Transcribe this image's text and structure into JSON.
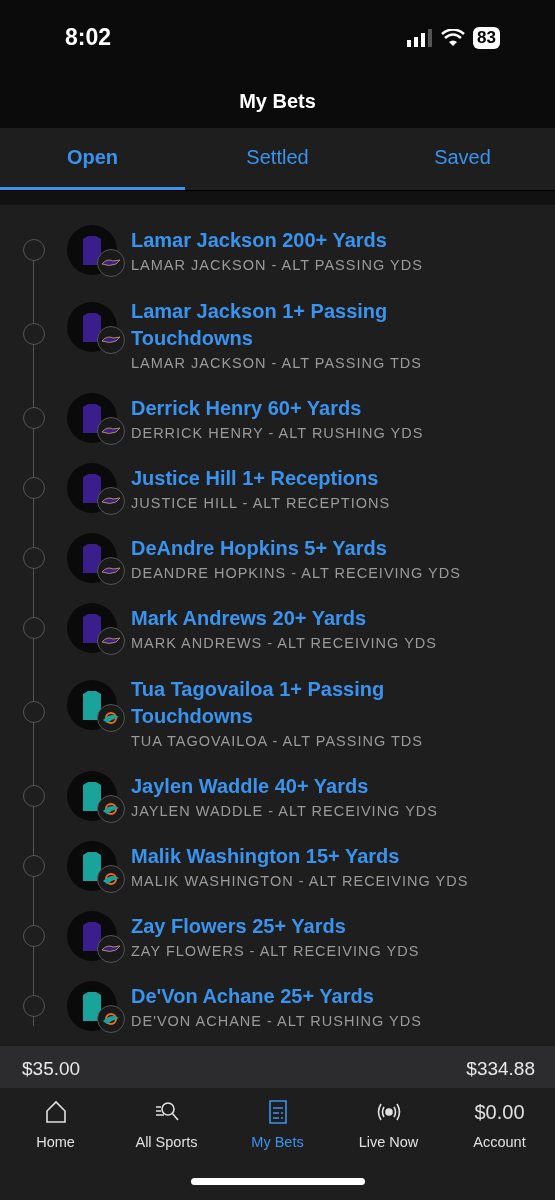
{
  "status_bar": {
    "time": "8:02",
    "battery": "83"
  },
  "header": {
    "title": "My Bets"
  },
  "tabs": [
    {
      "label": "Open",
      "selected": true
    },
    {
      "label": "Settled",
      "selected": false
    },
    {
      "label": "Saved",
      "selected": false
    }
  ],
  "bets": [
    {
      "title": "Lamar Jackson 200+ Yards",
      "subtitle": "LAMAR JACKSON - ALT PASSING YDS",
      "color": "#3a1f8c",
      "kind": "bird"
    },
    {
      "title": "Lamar Jackson 1+ Passing Touchdowns",
      "subtitle": "LAMAR JACKSON - ALT PASSING TDS",
      "color": "#3a1f8c",
      "kind": "bird"
    },
    {
      "title": "Derrick Henry 60+ Yards",
      "subtitle": "DERRICK HENRY - ALT RUSHING YDS",
      "color": "#3a1f8c",
      "kind": "bird"
    },
    {
      "title": "Justice Hill 1+ Receptions",
      "subtitle": "JUSTICE HILL - ALT RECEPTIONS",
      "color": "#3a1f8c",
      "kind": "bird"
    },
    {
      "title": "DeAndre Hopkins 5+ Yards",
      "subtitle": "DEANDRE HOPKINS - ALT RECEIVING YDS",
      "color": "#3a1f8c",
      "kind": "bird"
    },
    {
      "title": "Mark Andrews 20+ Yards",
      "subtitle": "MARK ANDREWS - ALT RECEIVING YDS",
      "color": "#3a1f8c",
      "kind": "bird"
    },
    {
      "title": "Tua Tagovailoa 1+ Passing Touchdowns",
      "subtitle": "TUA TAGOVAILOA - ALT PASSING TDS",
      "color": "#1aa39a",
      "kind": "fish"
    },
    {
      "title": "Jaylen Waddle 40+ Yards",
      "subtitle": "JAYLEN WADDLE - ALT RECEIVING YDS",
      "color": "#1aa39a",
      "kind": "fish"
    },
    {
      "title": "Malik Washington 15+ Yards",
      "subtitle": "MALIK WASHINGTON - ALT RECEIVING YDS",
      "color": "#1aa39a",
      "kind": "fish"
    },
    {
      "title": "Zay Flowers 25+ Yards",
      "subtitle": "ZAY FLOWERS - ALT RECEIVING YDS",
      "color": "#3a1f8c",
      "kind": "bird"
    },
    {
      "title": "De'Von Achane 25+ Yards",
      "subtitle": "DE'VON ACHANE - ALT RUSHING YDS",
      "color": "#1aa39a",
      "kind": "fish"
    }
  ],
  "summary": {
    "wager": "$35.00",
    "payout": "$334.88"
  },
  "nav": [
    {
      "label": "Home",
      "kind": "home",
      "selected": false
    },
    {
      "label": "All Sports",
      "kind": "search",
      "selected": false
    },
    {
      "label": "My Bets",
      "kind": "slip",
      "selected": true
    },
    {
      "label": "Live Now",
      "kind": "live",
      "selected": false
    },
    {
      "label": "Account",
      "kind": "balance",
      "value": "$0.00",
      "selected": false
    }
  ]
}
